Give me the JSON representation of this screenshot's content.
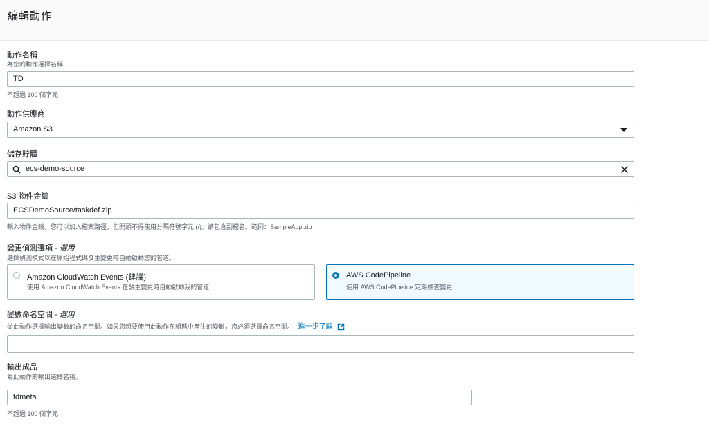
{
  "page": {
    "title": "編輯動作"
  },
  "action_name": {
    "label": "動作名稱",
    "description": "為您的動作選擇名稱",
    "value": "TD",
    "constraint": "不超過 100 個字元"
  },
  "action_provider": {
    "label": "動作供應商",
    "value": "Amazon S3"
  },
  "bucket": {
    "label": "儲存貯體",
    "value": "ecs-demo-source"
  },
  "s3_object_key": {
    "label": "S3 物件金鑰",
    "value": "ECSDemoSource/taskdef.zip",
    "hint": "輸入物件金鑰。您可以加入檔案路徑，但開頭不得使用分隔符號字元 (/)。請包含副檔名。範例：SampleApp.zip"
  },
  "change_detection": {
    "label": "變更偵測選項 - ",
    "optional": "選用",
    "description": "選擇偵測模式以在原始程式碼發生變更時自動啟動您的管道。",
    "options": [
      {
        "title": "Amazon CloudWatch Events (建議)",
        "description": "使用 Amazon CloudWatch Events 在發生變更時自動啟動我的管道",
        "selected": false
      },
      {
        "title": "AWS CodePipeline",
        "description": "使用 AWS CodePipeline 定期檢查變更",
        "selected": true
      }
    ]
  },
  "variable_namespace": {
    "label": "變數命名空間 - ",
    "optional": "選用",
    "description": "從此動作選擇輸出變數的命名空間。如果您想要使用此動作在組態中產生的變數，您必須選擇命名空間。",
    "link": "進一步了解",
    "value": ""
  },
  "output_artifact": {
    "label": "輸出成品",
    "description": "為此動作的輸出選擇名稱。",
    "value": "tdmeta",
    "constraint": "不超過 100 個字元"
  },
  "colors": {
    "accent": "#0073bb",
    "border": "#aab7b8",
    "text": "#16191f",
    "muted": "#545b64"
  }
}
